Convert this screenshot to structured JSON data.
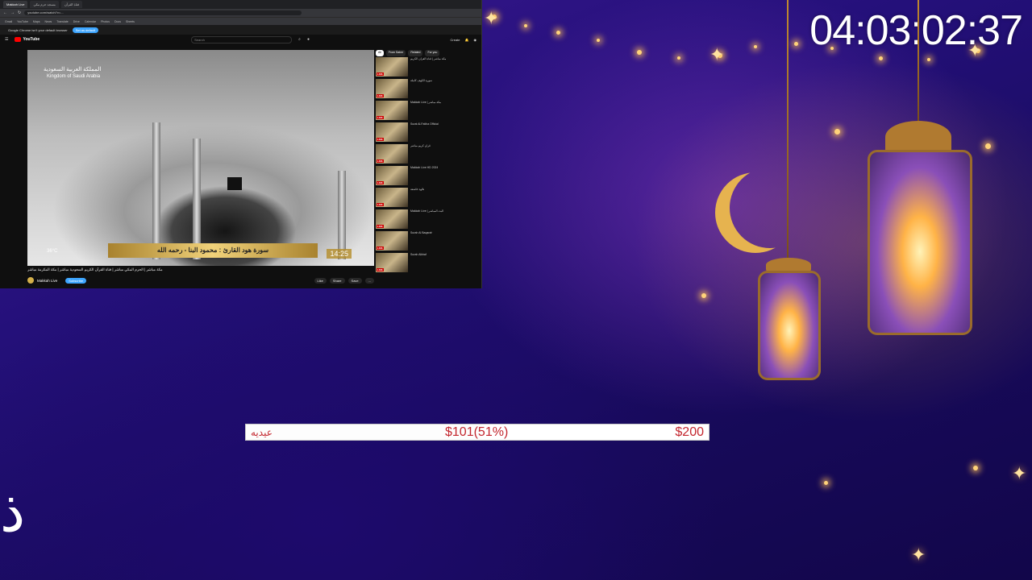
{
  "countdown": "04:03:02:37",
  "browser": {
    "tabs": [
      "Makkah Live",
      "مسجد حرم مكى",
      "قناة القرآن"
    ],
    "url": "youtube.com/watch?v=...",
    "bookmarks": [
      "Gmail",
      "YouTube",
      "Maps",
      "News",
      "Translate",
      "Drive",
      "Calendar",
      "Photos",
      "Docs",
      "Sheets"
    ],
    "notice_text": "Google Chrome isn't your default browser",
    "notice_button": "Set as default",
    "yt_logo": "YouTube",
    "search_placeholder": "Search",
    "create_label": "Create"
  },
  "video": {
    "overlay_ar": "المملكة العربية السعودية",
    "overlay_en": "Kingdom of Saudi Arabia",
    "banner": "سورة هود   القارئ : محمود البنا - رحمه الله",
    "time": "14:25",
    "temp": "36°C",
    "title": "مكة مباشر | الحرم المكي مباشر | قناة القرآن الكريم السعودية مباشر | مكة المكرمة مباشر",
    "channel": "Makkah Live",
    "subscribe": "Subscribe",
    "actions": [
      "Like",
      "Share",
      "Save",
      "..."
    ]
  },
  "sidebar": {
    "chips": [
      "All",
      "From Saher",
      "Related",
      "For you"
    ],
    "items": [
      {
        "text": "مكة مباشر | قناة القرآن الكريم",
        "badge": "LIVE"
      },
      {
        "text": "سورة الكهف كاملة",
        "badge": "LIVE"
      },
      {
        "text": "Makkah Live | مكة مباشر",
        "badge": "LIVE"
      },
      {
        "text": "Surat Al-Fatiha Official",
        "badge": "LIVE"
      },
      {
        "text": "قرآن كريم مباشر",
        "badge": "LIVE"
      },
      {
        "text": "Makkah Live HD 2024",
        "badge": "LIVE"
      },
      {
        "text": "تلاوة خاشعة",
        "badge": "LIVE"
      },
      {
        "text": "Makkah Live | البث المباشر",
        "badge": "LIVE"
      },
      {
        "text": "Surah Al Baqarah",
        "badge": "LIVE"
      },
      {
        "text": "Surah Alkhaf",
        "badge": "LIVE"
      }
    ]
  },
  "goal": {
    "name": "عيديه",
    "current": "$101(51%)",
    "target": "$200",
    "progress": 0.51,
    "accent": "#c3262e"
  },
  "bottom_letter": "ذ"
}
